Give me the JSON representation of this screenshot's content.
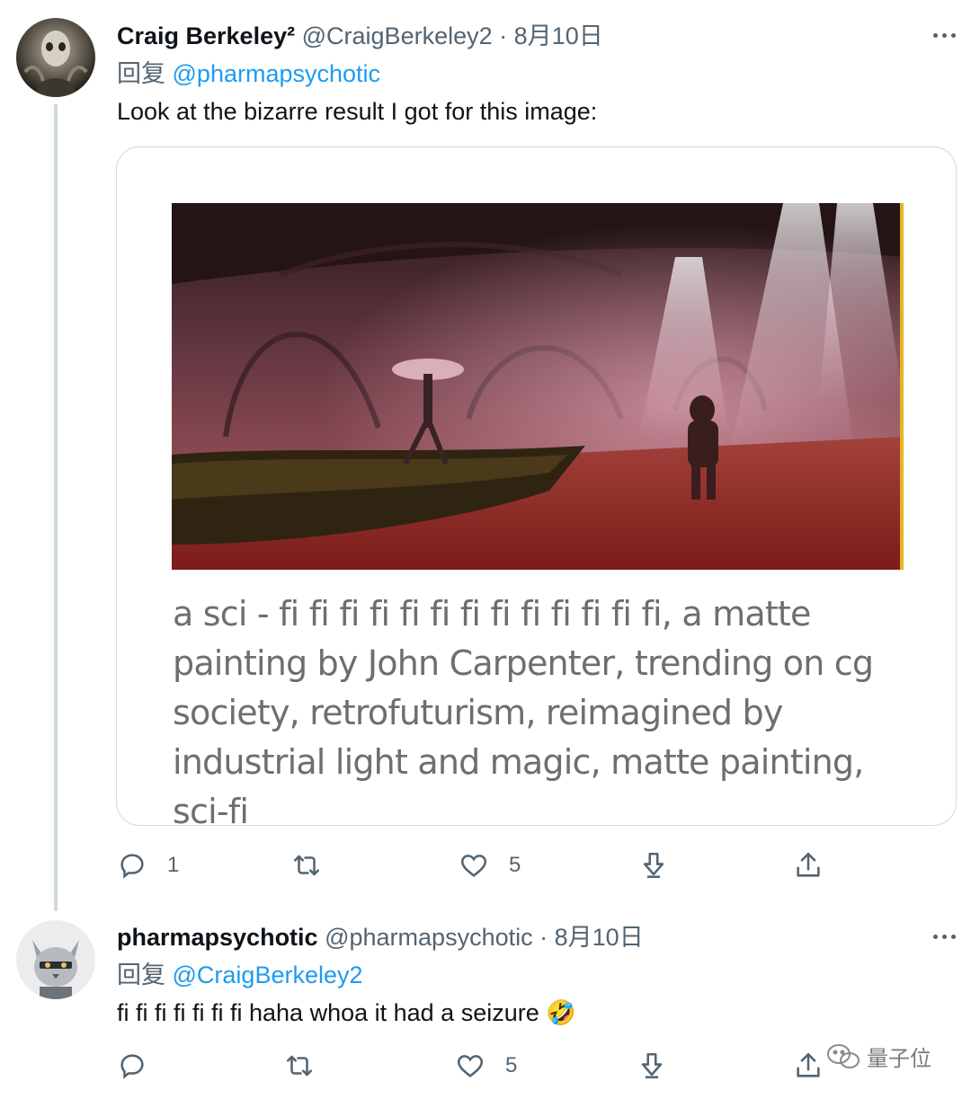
{
  "tweets": [
    {
      "display_name": "Craig Berkeley²",
      "handle": "@CraigBerkeley2",
      "separator": "·",
      "date": "8月10日",
      "reply_prefix": "回复",
      "reply_mention": "@pharmapsychotic",
      "text": "Look at the bizarre result I got for this image:",
      "card_caption": "a sci - fi fi fi fi fi fi fi fi fi fi fi fi fi, a matte painting by John Carpenter, trending on cg society, retrofuturism, reimagined by industrial light and magic, matte painting, sci-fi",
      "reply_count": "1",
      "like_count": "5"
    },
    {
      "display_name": "pharmapsychotic",
      "handle": "@pharmapsychotic",
      "separator": "·",
      "date": "8月10日",
      "reply_prefix": "回复",
      "reply_mention": "@CraigBerkeley2",
      "text": "fi fi fi fi fi fi fi haha whoa it had a seizure",
      "emoji": "🤣",
      "reply_count": "",
      "like_count": "5"
    }
  ],
  "icons": {
    "more": "more-horizontal-icon",
    "reply": "reply-bubble-icon",
    "retweet": "retweet-icon",
    "like": "heart-icon",
    "download": "download-arrow-icon",
    "share": "share-upload-icon"
  },
  "colors": {
    "link": "#1d9bf0",
    "secondary_text": "#536471",
    "border": "#cfd9de"
  },
  "watermark": {
    "text": "量子位"
  }
}
